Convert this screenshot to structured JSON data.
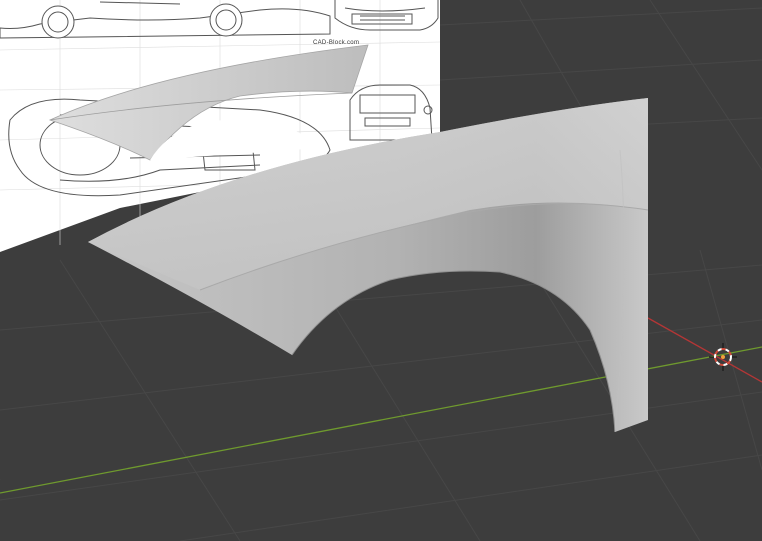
{
  "viewport": {
    "background_color": "#3d3d3d",
    "grid_color": "#4a4a4a",
    "x_axis_color": "#c03a3a",
    "y_axis_color": "#6f9a2e"
  },
  "reference_image": {
    "watermark_text": "CAD-Block.com",
    "sheet_color": "#ffffff"
  },
  "mesh": {
    "color": "#bdbdbd",
    "shadow_color": "#8a8a8a"
  },
  "cursor": {
    "name": "3d-cursor-icon",
    "ring_color_a": "#d24b3a",
    "ring_color_b": "#ffffff",
    "center_color": "#f2a13a"
  }
}
